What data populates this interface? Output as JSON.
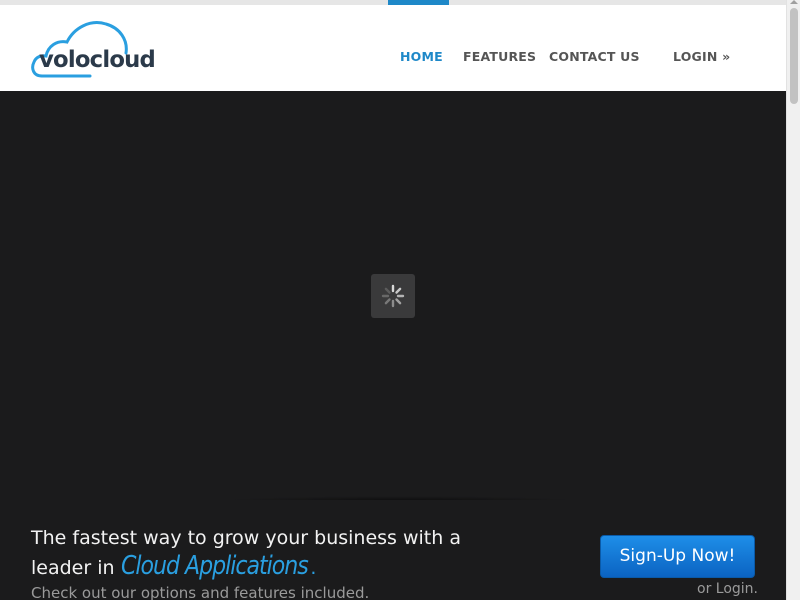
{
  "header": {
    "logo_text": "volocloud",
    "nav": [
      {
        "label": "HOME",
        "active": true
      },
      {
        "label": "FEATURES",
        "active": false
      },
      {
        "label": "CONTACT US",
        "active": false
      },
      {
        "label": "LOGIN »",
        "active": false
      }
    ]
  },
  "callout": {
    "headline_start": "The fastest way to grow your business with a leader in ",
    "headline_highlight": "Cloud Applications",
    "headline_end": ".",
    "subline": "Check out our options and features included.",
    "signup_label": "Sign-Up Now!",
    "login_text": "or Login."
  },
  "colors": {
    "accent": "#1e88c8",
    "highlight": "#2a9fe0",
    "button": "#1479d6",
    "hero_background": "#1b1b1c"
  },
  "icons": {
    "loader": "spinner-icon"
  }
}
